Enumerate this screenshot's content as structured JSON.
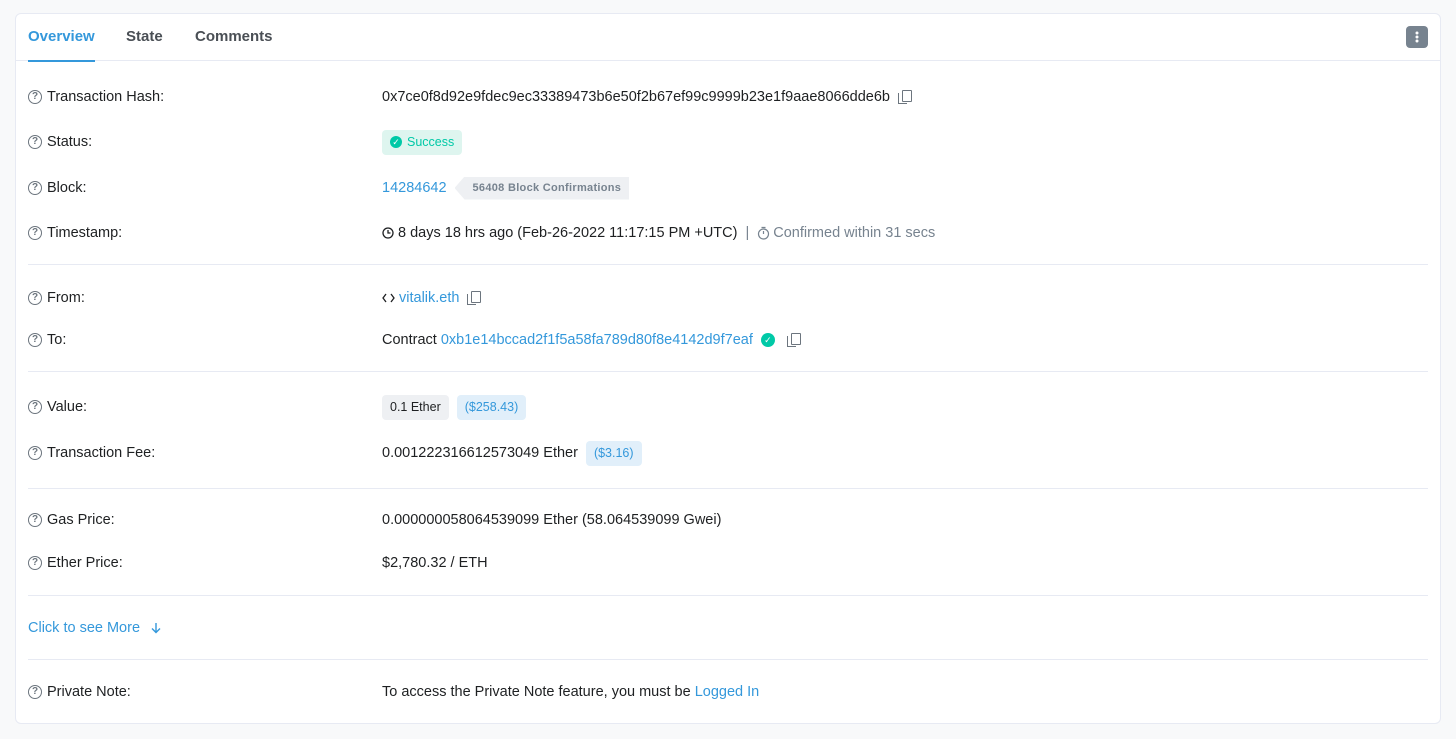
{
  "tabs": [
    "Overview",
    "State",
    "Comments"
  ],
  "rows": {
    "hash": {
      "label": "Transaction Hash:",
      "value": "0x7ce0f8d92e9fdec9ec33389473b6e50f2b67ef99c9999b23e1f9aae8066dde6b"
    },
    "status": {
      "label": "Status:",
      "value": "Success"
    },
    "block": {
      "label": "Block:",
      "value": "14284642",
      "confirmations": "56408 Block Confirmations"
    },
    "timestamp": {
      "label": "Timestamp:",
      "value": "8 days 18 hrs ago (Feb-26-2022 11:17:15 PM +UTC)",
      "separator": "|",
      "confirmed": "Confirmed within 31 secs"
    },
    "from": {
      "label": "From:",
      "value": "vitalik.eth"
    },
    "to": {
      "label": "To:",
      "prefix": "Contract",
      "value": "0xb1e14bccad2f1f5a58fa789d80f8e4142d9f7eaf"
    },
    "value": {
      "label": "Value:",
      "amount": "0.1 Ether",
      "usd": "($258.43)"
    },
    "fee": {
      "label": "Transaction Fee:",
      "amount": "0.001222316612573049 Ether",
      "usd": "($3.16)"
    },
    "gas": {
      "label": "Gas Price:",
      "value": "0.000000058064539099 Ether (58.064539099 Gwei)"
    },
    "ether_price": {
      "label": "Ether Price:",
      "value": "$2,780.32 / ETH"
    },
    "private_note": {
      "label": "Private Note:",
      "value": "To access the Private Note feature, you must be",
      "link": "Logged In"
    }
  },
  "more_link": "Click to see More",
  "help_glyph": "?",
  "icons": {
    "help": "question-circle-icon",
    "copy": "copy-icon",
    "clock": "clock-icon",
    "timer": "stopwatch-icon",
    "code": "code-icon",
    "check": "check-circle-icon",
    "arrow": "arrow-down-icon",
    "menu": "vertical-dots-icon"
  },
  "colors": {
    "accent": "#3498db",
    "success": "#00c9a7",
    "muted": "#77838f"
  }
}
